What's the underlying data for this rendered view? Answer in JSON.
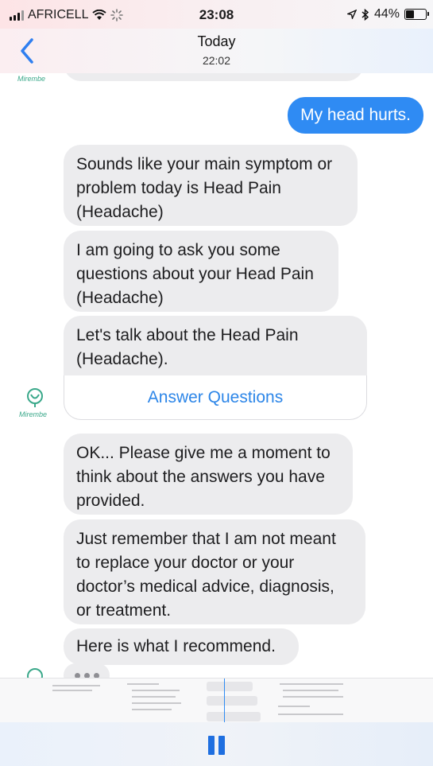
{
  "status_bar": {
    "carrier": "AFRICELL",
    "time": "23:08",
    "battery": "44%",
    "battery_level": 0.44
  },
  "nav": {
    "title": "Today",
    "subtitle": "22:02"
  },
  "chat": {
    "bot_name": "Mirembe",
    "user_message": "My head hurts.",
    "bot_messages": [
      "Sounds like your main symptom or problem today is Head Pain (Headache)",
      "I am going to ask you some questions about your Head Pain (Headache)",
      "Let's talk about the Head Pain (Headache)."
    ],
    "answer_button": "Answer Questions",
    "bot_messages_2": [
      "OK... Please give me a moment to think about the answers you have provided.",
      "Just remember that I am not meant to replace your doctor or your doctor’s medical advice, diagnosis, or treatment.",
      "Here is what I recommend."
    ]
  },
  "colors": {
    "user_bubble": "#2f8bf3",
    "bot_bubble": "#ececee",
    "link": "#2d86e8",
    "brand": "#3aa88a"
  },
  "icons": {
    "back": "chevron-left-icon",
    "avatar": "stethoscope-avatar-icon",
    "pause": "pause-icon"
  }
}
